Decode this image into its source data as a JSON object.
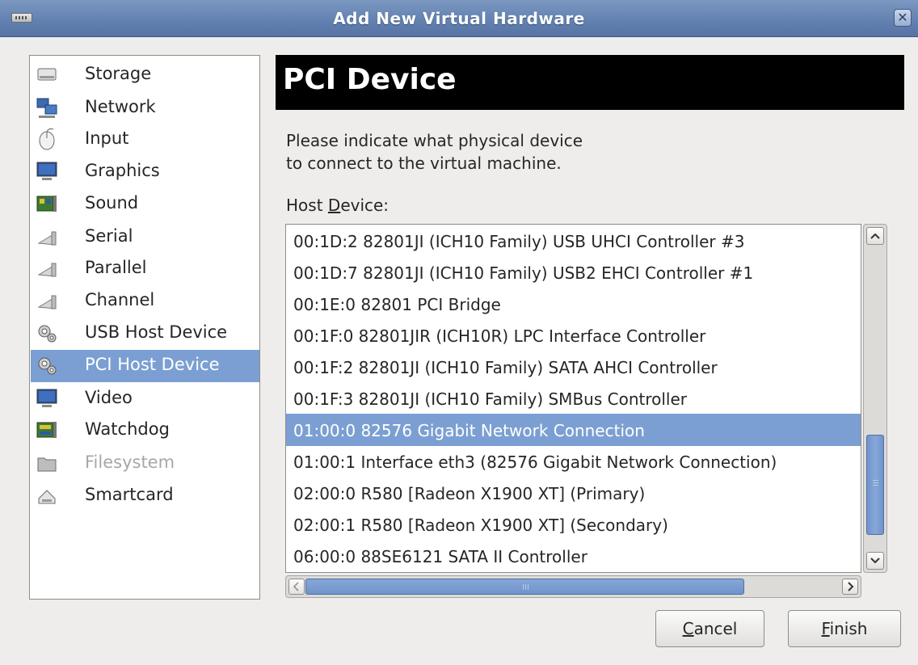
{
  "window": {
    "title": "Add New Virtual Hardware",
    "close_glyph": "✕"
  },
  "sidebar": {
    "selected_index": 9,
    "items": [
      {
        "label": "Storage",
        "icon": "storage-icon",
        "disabled": false
      },
      {
        "label": "Network",
        "icon": "network-icon",
        "disabled": false
      },
      {
        "label": "Input",
        "icon": "mouse-icon",
        "disabled": false
      },
      {
        "label": "Graphics",
        "icon": "monitor-icon",
        "disabled": false
      },
      {
        "label": "Sound",
        "icon": "sound-card-icon",
        "disabled": false
      },
      {
        "label": "Serial",
        "icon": "serial-port-icon",
        "disabled": false
      },
      {
        "label": "Parallel",
        "icon": "parallel-port-icon",
        "disabled": false
      },
      {
        "label": "Channel",
        "icon": "channel-icon",
        "disabled": false
      },
      {
        "label": "USB Host Device",
        "icon": "usb-device-icon",
        "disabled": false
      },
      {
        "label": "PCI Host Device",
        "icon": "pci-device-icon",
        "disabled": false
      },
      {
        "label": "Video",
        "icon": "video-monitor-icon",
        "disabled": false
      },
      {
        "label": "Watchdog",
        "icon": "watchdog-card-icon",
        "disabled": false
      },
      {
        "label": "Filesystem",
        "icon": "folder-icon",
        "disabled": true
      },
      {
        "label": "Smartcard",
        "icon": "smartcard-reader-icon",
        "disabled": false
      }
    ]
  },
  "main": {
    "heading": "PCI Device",
    "description_line1": "Please indicate what physical device",
    "description_line2": "to connect to the virtual machine.",
    "host_device_label_pre": "Host ",
    "host_device_label_mnemonic": "D",
    "host_device_label_post": "evice:",
    "selected_index": 6,
    "devices": [
      "00:1D:2 82801JI (ICH10 Family) USB UHCI Controller #3",
      "00:1D:7 82801JI (ICH10 Family) USB2 EHCI Controller #1",
      "00:1E:0 82801 PCI Bridge",
      "00:1F:0 82801JIR (ICH10R) LPC Interface Controller",
      "00:1F:2 82801JI (ICH10 Family) SATA AHCI Controller",
      "00:1F:3 82801JI (ICH10 Family) SMBus Controller",
      "01:00:0 82576 Gigabit Network Connection",
      "01:00:1 Interface eth3 (82576 Gigabit Network Connection)",
      "02:00:0 R580 [Radeon X1900 XT] (Primary)",
      "02:00:1 R580 [Radeon X1900 XT] (Secondary)",
      "06:00:0 88SE6121 SATA II Controller"
    ],
    "vscroll_position": 0.75,
    "hscroll_position": 0.0
  },
  "buttons": {
    "cancel_mnemonic": "C",
    "cancel_rest": "ancel",
    "finish_mnemonic": "F",
    "finish_rest": "inish"
  },
  "colors": {
    "selection": "#7b9fd2",
    "titlebar": "#6382b1"
  }
}
